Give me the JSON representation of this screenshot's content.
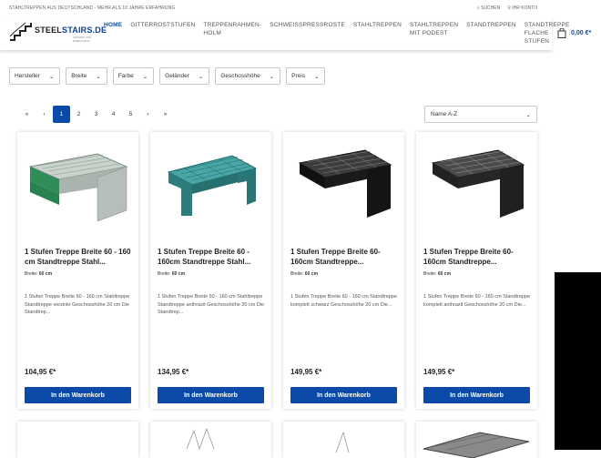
{
  "topbar": {
    "tagline": "STAHLTREPPEN AUS DEUTSCHLAND - MEHR ALS 10 JAHRE ERFAHRUNG",
    "search": "SUCHEN",
    "account": "IHR KONTO"
  },
  "logo": {
    "brand_a": "STEEL",
    "brand_b": "STAIRS.DE",
    "sub": "TECHNIK AUS EINEM HAUS"
  },
  "nav": [
    {
      "label": "HOME"
    },
    {
      "label": "GITTERROSTSTUFEN"
    },
    {
      "label": "TREPPENRAHMEN-\nHOLM"
    },
    {
      "label": "SCHWEISSPRESSROSTE"
    },
    {
      "label": "STAHLTREPPEN"
    },
    {
      "label": "STAHLTREPPEN\nMIT PODEST"
    },
    {
      "label": "STANDTREPPEN"
    },
    {
      "label": "STANDTREPPE\nFLACHE\nSTUFEN"
    }
  ],
  "cart": {
    "amount": "0,00 €*"
  },
  "filters": [
    {
      "label": "Hersteller"
    },
    {
      "label": "Breite"
    },
    {
      "label": "Farbe"
    },
    {
      "label": "Geländer"
    },
    {
      "label": "Geschosshöhe"
    },
    {
      "label": "Preis"
    }
  ],
  "pager": {
    "first": "«",
    "prev": "‹",
    "pages": [
      "1",
      "2",
      "3",
      "4",
      "5"
    ],
    "next": "›",
    "last": "»"
  },
  "sort": {
    "selected": "Name A-Z"
  },
  "products": [
    {
      "title": "1 Stufen Treppe Breite 60 - 160 cm Standtreppe Stahl...",
      "width_label": "Breite:",
      "width_value": "60 cm",
      "desc": "1 Stufen Treppe Breite 60 - 160 cm Stahltreppe Standtreppe verzinkt Geschosshöhe 20 cm Die Standtrep...",
      "price": "104,95 €*",
      "buy": "In den Warenkorb",
      "color": "#9aa59e"
    },
    {
      "title": "1 Stufen Treppe Breite 60 - 160cm Standtreppe Stahl...",
      "width_label": "Breite:",
      "width_value": "60 cm",
      "desc": "1 Stufen Treppe Breite 60 - 160 cm Stahltreppe Standtreppe anthrazit Geschosshöhe 20 cm Die Standtrep...",
      "price": "134,95 €*",
      "buy": "In den Warenkorb",
      "color": "#3b8c8c"
    },
    {
      "title": "1 Stufen Treppe Breite 60-160cm Standtreppe...",
      "width_label": "Breite:",
      "width_value": "60 cm",
      "desc": "1 Stufen Treppe Breite 60 - 160 cm Standtreppe komplett schwarz Geschosshöhe 20 cm Die...",
      "price": "149,95 €*",
      "buy": "In den Warenkorb",
      "color": "#1c1c1c"
    },
    {
      "title": "1 Stufen Treppe Breite 60-160cm Standtreppe...",
      "width_label": "Breite:",
      "width_value": "60 cm",
      "desc": "1 Stufen Treppe Breite 60 - 160 cm Standtreppe komplett anthrazit Geschosshöhe 20 cm Die...",
      "price": "149,95 €*",
      "buy": "In den Warenkorb",
      "color": "#2a2a2a"
    }
  ]
}
